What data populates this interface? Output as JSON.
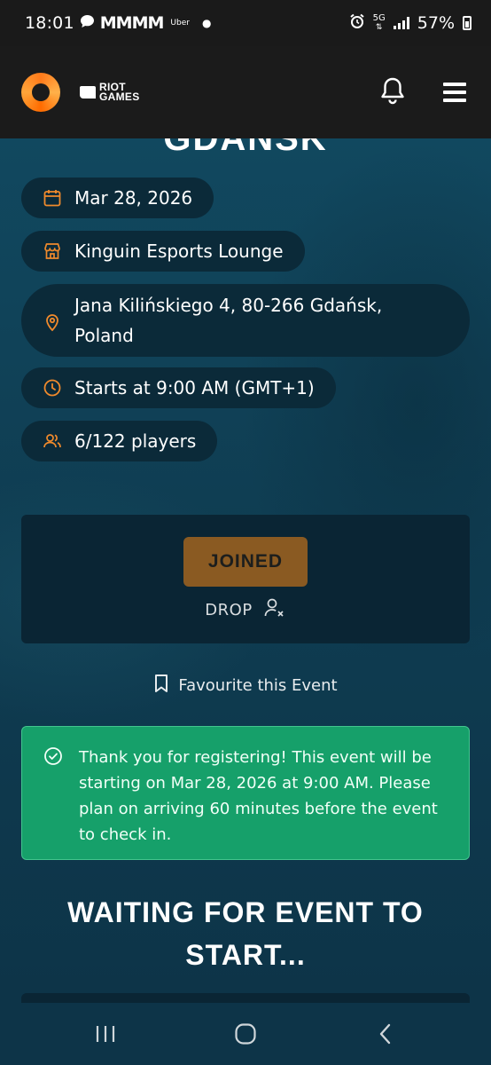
{
  "status_bar": {
    "time": "18:01",
    "app_letters": "MMMM",
    "uber": "Uber",
    "network": "5G",
    "battery": "57%"
  },
  "header": {
    "riot_line1": "RIOT",
    "riot_line2": "GAMES"
  },
  "event": {
    "title_partial": "GDANSK",
    "date": "Mar 28, 2026",
    "venue": "Kinguin Esports Lounge",
    "address": "Jana Kilińskiego 4, 80-266 Gdańsk, Poland",
    "start_time": "Starts at 9:00 AM (GMT+1)",
    "players": "6/122 players"
  },
  "actions": {
    "joined_label": "JOINED",
    "drop_label": "DROP",
    "favourite_label": "Favourite this Event"
  },
  "notice": {
    "text": "Thank you for registering! This event will be starting on Mar 28, 2026 at 9:00 AM. Please plan on arriving 60 minutes before the event to check in."
  },
  "waiting_title": "WAITING FOR EVENT TO START...",
  "colors": {
    "accent_orange": "#f08a2c",
    "joined_bg": "#8a5a22",
    "notice_green": "#16a06a",
    "page_bg": "#0f3a4e"
  }
}
